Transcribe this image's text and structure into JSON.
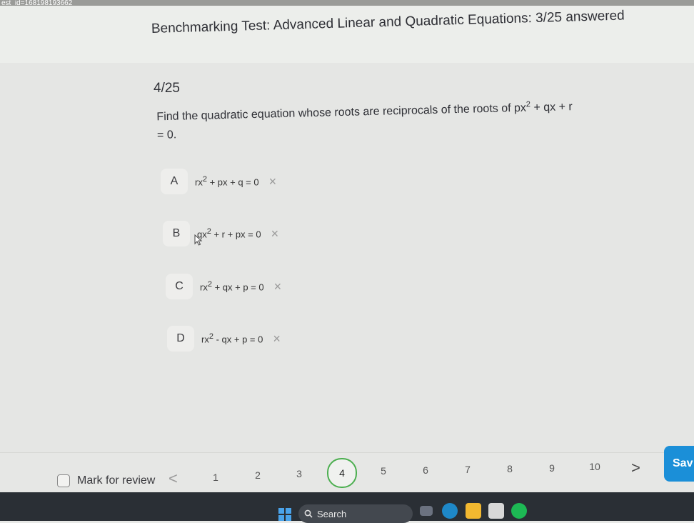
{
  "url_fragment": "est_id=168198193662",
  "header": {
    "title": "Benchmarking Test: Advanced Linear and Quadratic Equations: 3/25 answered"
  },
  "question": {
    "number": "4/25",
    "text_part1": "Find the quadratic equation whose roots are reciprocals of the roots of ",
    "text_expr_a": "px",
    "text_expr_b": " + qx + r",
    "text_part2": "= 0."
  },
  "options": [
    {
      "letter": "A",
      "pre": "rx",
      "post": " + px + q = 0"
    },
    {
      "letter": "B",
      "pre": "qx",
      "post": " + r + px = 0"
    },
    {
      "letter": "C",
      "pre": "rx",
      "post": " + qx + p = 0"
    },
    {
      "letter": "D",
      "pre": "rx",
      "post": " - qx + p = 0"
    }
  ],
  "exponent": "2",
  "strike_glyph": "×",
  "footer": {
    "review_label": "Mark for review",
    "prev_glyph": "<",
    "next_glyph": ">",
    "pages": [
      "1",
      "2",
      "3",
      "4",
      "5",
      "6",
      "7",
      "8",
      "9",
      "10"
    ],
    "current_page": "4",
    "save_label": "Sav"
  },
  "taskbar": {
    "search_label": "Search"
  },
  "colors": {
    "accent": "#1b8fd8",
    "active_page_ring": "#4caf50"
  }
}
